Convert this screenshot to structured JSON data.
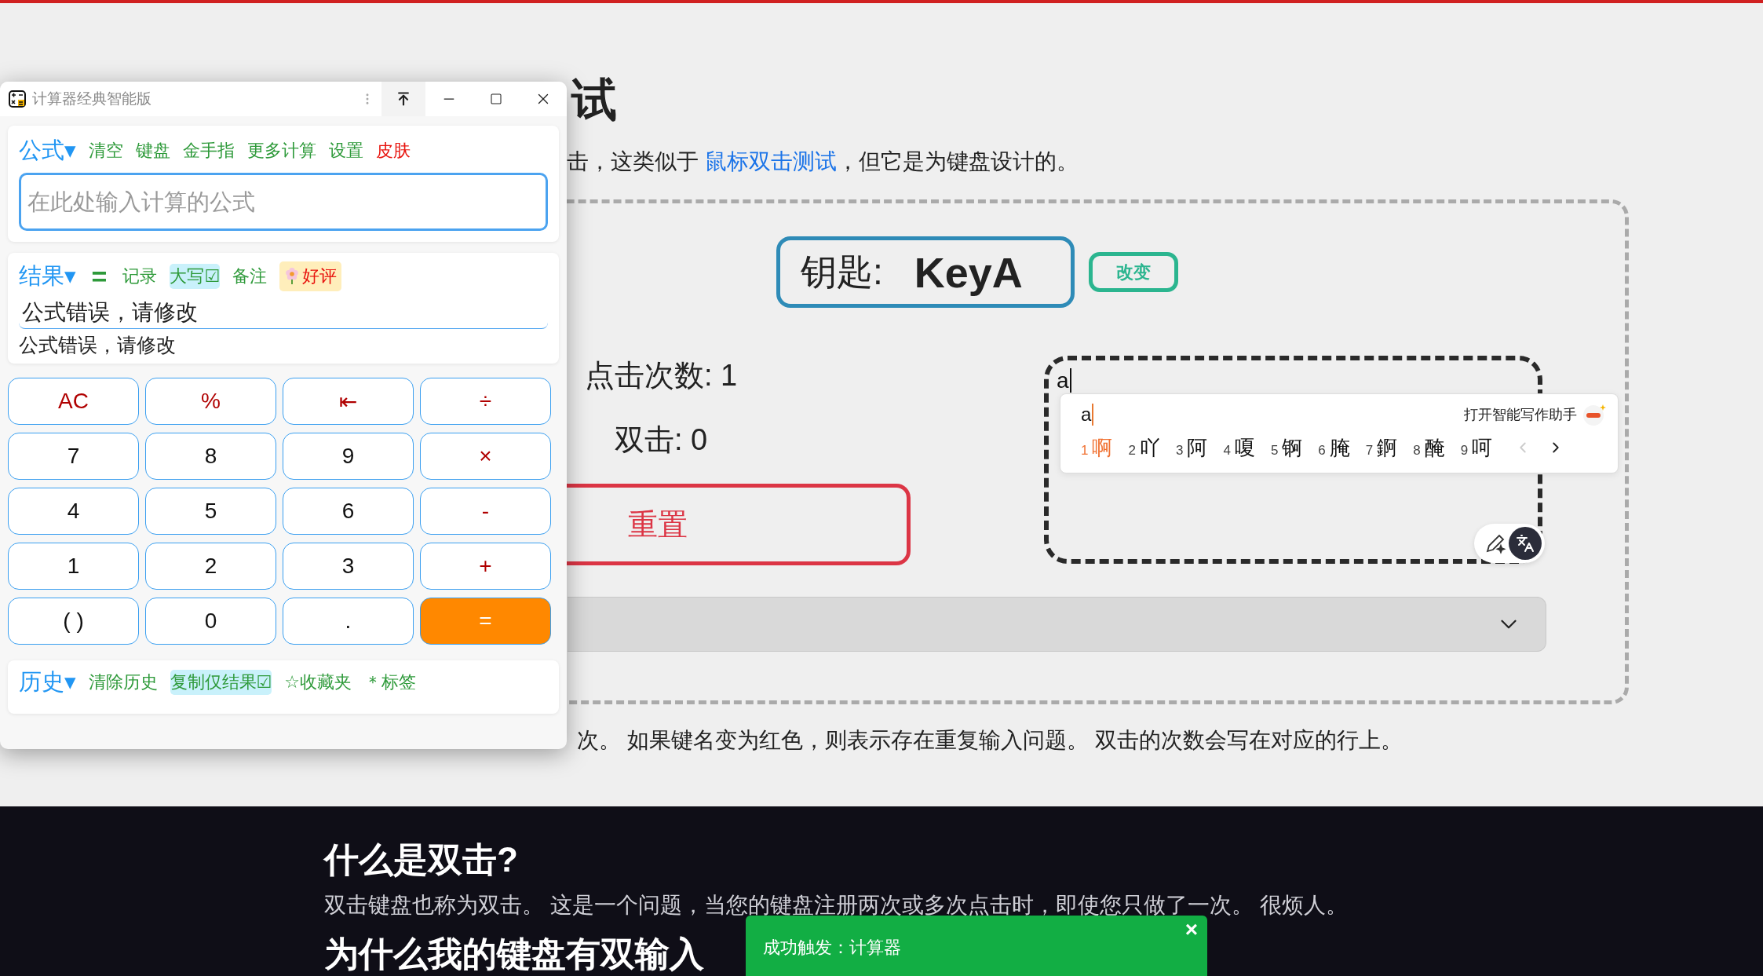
{
  "page": {
    "title_fragment": "试",
    "intro": {
      "before": "击，这类似于 ",
      "link": "鼠标双击测试",
      "after": "，但它是为键盘设计的。"
    },
    "key_label": "钥匙:",
    "key_value": "KeyA",
    "change_button": "改变",
    "press_count": "点击次数: 1",
    "double_count": "双击: 0",
    "reset_button": "重置",
    "test_input": {
      "value": "a"
    },
    "ime": {
      "composition": "a",
      "assistant": "打开智能写作助手",
      "prev_enabled": false,
      "next_enabled": true,
      "candidates": [
        {
          "index": "1",
          "text": "啊",
          "selected": true
        },
        {
          "index": "2",
          "text": "吖",
          "selected": false
        },
        {
          "index": "3",
          "text": "阿",
          "selected": false
        },
        {
          "index": "4",
          "text": "嗄",
          "selected": false
        },
        {
          "index": "5",
          "text": "锕",
          "selected": false
        },
        {
          "index": "6",
          "text": "腌",
          "selected": false
        },
        {
          "index": "7",
          "text": "錒",
          "selected": false
        },
        {
          "index": "8",
          "text": "醃",
          "selected": false
        },
        {
          "index": "9",
          "text": "呵",
          "selected": false
        }
      ]
    },
    "instructions": "次。 如果键名变为红色，则表示存在重复输入问题。 双击的次数会写在对应的行上。",
    "faq": [
      {
        "kind": "heading",
        "text": "什么是双击?"
      },
      {
        "kind": "paragraph",
        "text": "双击键盘也称为双击。 这是一个问题，当您的键盘注册两次或多次点击时，即使您只做了一次。 很烦人。"
      },
      {
        "kind": "heading",
        "text": "为什么我的键盘有双输入"
      }
    ]
  },
  "calculator": {
    "title": "计算器经典智能版",
    "formula_label": "公式▾",
    "formula_toolbar": [
      {
        "label": "清空",
        "kind": "action"
      },
      {
        "label": "键盘",
        "kind": "action"
      },
      {
        "label": "金手指",
        "kind": "action"
      },
      {
        "label": "更多计算",
        "kind": "action"
      },
      {
        "label": "设置",
        "kind": "action"
      },
      {
        "label": "皮肤",
        "kind": "accent"
      }
    ],
    "formula_input": {
      "placeholder": "在此处输入计算的公式"
    },
    "result_label": "结果▾",
    "equals": "=",
    "result_toolbar": [
      {
        "label": "记录",
        "kind": "action"
      },
      {
        "label": "大写☑",
        "kind": "toggle"
      },
      {
        "label": "备注",
        "kind": "action"
      },
      {
        "label": "好评",
        "kind": "rating"
      }
    ],
    "result_value": "公式错误，请修改",
    "result_preview": "公式错误，请修改",
    "keys": [
      {
        "label": "AC",
        "kind": "op"
      },
      {
        "label": "%",
        "kind": "op"
      },
      {
        "label": "⇤",
        "kind": "op"
      },
      {
        "label": "÷",
        "kind": "op"
      },
      {
        "label": "7",
        "kind": "digit"
      },
      {
        "label": "8",
        "kind": "digit"
      },
      {
        "label": "9",
        "kind": "digit"
      },
      {
        "label": "×",
        "kind": "op"
      },
      {
        "label": "4",
        "kind": "digit"
      },
      {
        "label": "5",
        "kind": "digit"
      },
      {
        "label": "6",
        "kind": "digit"
      },
      {
        "label": "-",
        "kind": "op"
      },
      {
        "label": "1",
        "kind": "digit"
      },
      {
        "label": "2",
        "kind": "digit"
      },
      {
        "label": "3",
        "kind": "digit"
      },
      {
        "label": "+",
        "kind": "op"
      },
      {
        "label": "( )",
        "kind": "digit"
      },
      {
        "label": "0",
        "kind": "digit"
      },
      {
        "label": ".",
        "kind": "digit"
      },
      {
        "label": "=",
        "kind": "equals"
      }
    ],
    "history_label": "历史▾",
    "history_toolbar": [
      {
        "label": "清除历史",
        "kind": "action"
      },
      {
        "label": "复制仅结果☑",
        "kind": "toggle"
      },
      {
        "label": "☆收藏夹",
        "kind": "action"
      },
      {
        "label": "＊标签",
        "kind": "action"
      }
    ]
  },
  "toast": {
    "message": "成功触发：计算器",
    "close": "×"
  }
}
